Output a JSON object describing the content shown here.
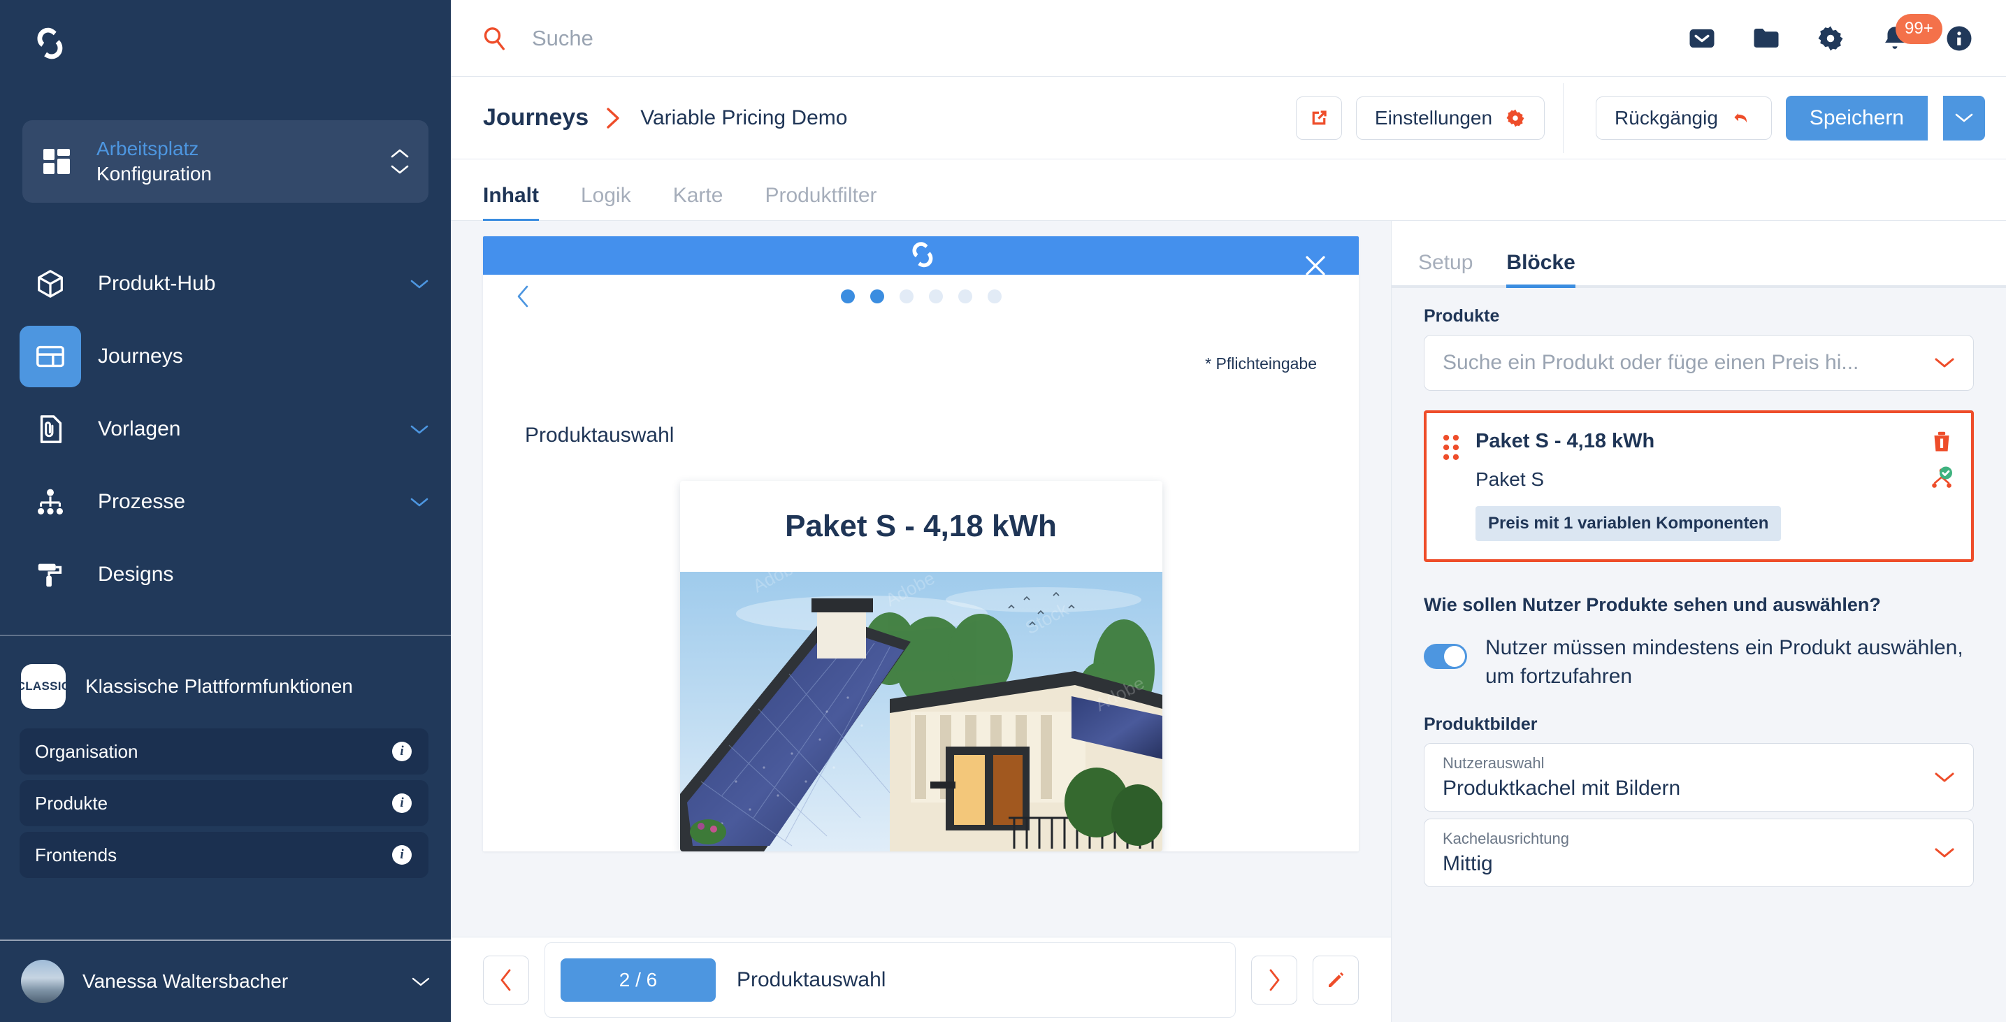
{
  "sidebar": {
    "logo_icon": "cycle-logo-icon",
    "workspace": {
      "top_label": "Arbeitsplatz",
      "bottom_label": "Konfiguration",
      "icon": "grid-icon"
    },
    "nav_items": [
      {
        "label": "Produkt-Hub",
        "icon": "cube-icon",
        "has_caret": true,
        "active": false
      },
      {
        "label": "Journeys",
        "icon": "layout-icon",
        "has_caret": false,
        "active": true
      },
      {
        "label": "Vorlagen",
        "icon": "document-clip-icon",
        "has_caret": true,
        "active": false
      },
      {
        "label": "Prozesse",
        "icon": "hierarchy-icon",
        "has_caret": true,
        "active": false
      },
      {
        "label": "Designs",
        "icon": "paint-roller-icon",
        "has_caret": false,
        "active": false
      }
    ],
    "classic": {
      "badge": "CLASSIC",
      "title": "Klassische Plattformfunktionen",
      "items": [
        {
          "label": "Organisation",
          "icon": "info-icon"
        },
        {
          "label": "Produkte",
          "icon": "info-icon"
        },
        {
          "label": "Frontends",
          "icon": "info-icon"
        }
      ]
    },
    "user": {
      "name": "Vanessa Waltersbacher",
      "avatar": "user-avatar",
      "caret": "chevron-down-icon"
    }
  },
  "topbar": {
    "search_placeholder": "Suche",
    "search_value": "",
    "search_icon": "search-icon",
    "icons": [
      {
        "name": "mail-icon"
      },
      {
        "name": "folder-icon"
      },
      {
        "name": "gear-icon"
      },
      {
        "name": "bell-icon",
        "badge": "99+"
      },
      {
        "name": "info-icon"
      }
    ]
  },
  "breadcrumb": {
    "root": "Journeys",
    "separator_icon": "chevron-right-icon",
    "current": "Variable Pricing Demo"
  },
  "toolbar": {
    "open_external_icon": "external-link-icon",
    "settings_label": "Einstellungen",
    "settings_icon": "gear-icon",
    "undo_label": "Rückgängig",
    "undo_icon": "undo-arrow-icon",
    "save_label": "Speichern",
    "save_caret_icon": "chevron-down-icon"
  },
  "tabs": [
    {
      "label": "Inhalt",
      "active": true
    },
    {
      "label": "Logik",
      "active": false
    },
    {
      "label": "Karte",
      "active": false
    },
    {
      "label": "Produktfilter",
      "active": false
    }
  ],
  "preview": {
    "header_logo_icon": "cycle-logo-icon",
    "close_icon": "close-icon",
    "back_icon": "chevron-left-icon",
    "steps_total": 6,
    "steps_filled": 2,
    "mandatory_note": "* Pflichteingabe",
    "section_title": "Produktauswahl",
    "product_card": {
      "title": "Paket S - 4,18 kWh",
      "image_alt": "solar-panel-house-photo"
    }
  },
  "pager": {
    "prev_icon": "chevron-left-icon",
    "next_icon": "chevron-right-icon",
    "edit_icon": "pencil-icon",
    "counter": "2 / 6",
    "label": "Produktauswahl"
  },
  "inspector": {
    "tabs": [
      {
        "label": "Setup",
        "active": false
      },
      {
        "label": "Blöcke",
        "active": true
      }
    ],
    "products_label": "Produkte",
    "products_search_placeholder": "Suche ein Produkt oder füge einen Preis hi...",
    "product_item": {
      "grip_icon": "drag-handle-icon",
      "name": "Paket S - 4,18 kWh",
      "subtitle": "Paket S",
      "tag": "Preis mit 1 variablen Komponenten",
      "delete_icon": "trash-icon",
      "status_icon": "variant-check-icon"
    },
    "question": "Wie sollen Nutzer Produkte sehen und auswählen?",
    "toggle": {
      "on": true,
      "label": "Nutzer müssen mindestens ein Produkt auswählen, um fortzufahren"
    },
    "images_label": "Produktbilder",
    "selects": [
      {
        "small": "Nutzerauswahl",
        "value": "Produktkachel mit Bildern",
        "caret": "chevron-down-icon"
      },
      {
        "small": "Kachelausrichtung",
        "value": "Mittig",
        "caret": "chevron-down-icon"
      }
    ]
  },
  "colors": {
    "sidebar_bg": "#21395a",
    "accent_blue": "#4d96e0",
    "accent_orange": "#ee4d2a",
    "badge_orange": "#f4714a",
    "panel_bg": "#f3f5f9",
    "text_dark": "#1f3556"
  }
}
